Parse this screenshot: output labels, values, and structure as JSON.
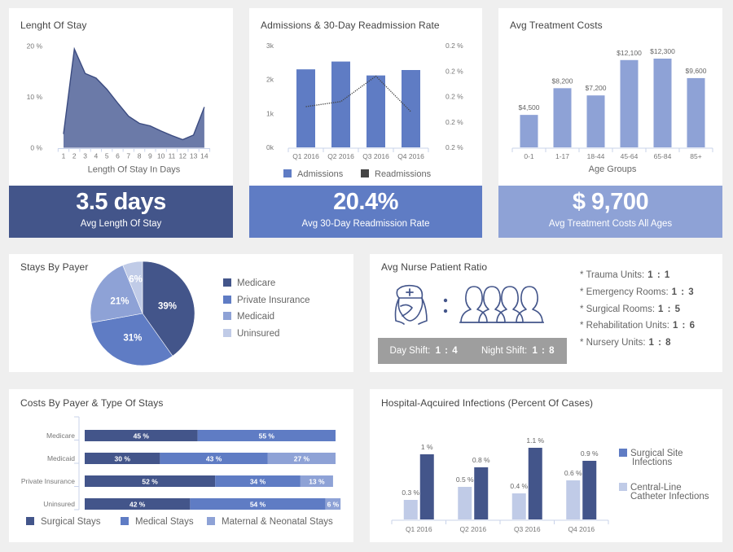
{
  "colors": {
    "navy": "#43558a",
    "blue": "#5f7cc4",
    "light_blue": "#8ea2d6",
    "pale_blue": "#c0cbe7",
    "gray": "#9e9e9e",
    "dark_gray": "#444444",
    "background": "#efefef"
  },
  "length_of_stay": {
    "title": "Lenght Of Stay",
    "kpi_value": "3.5 days",
    "kpi_label": "Avg Length Of Stay"
  },
  "admissions": {
    "title": "Admissions & 30-Day Readmission Rate",
    "kpi_value": "20.4%",
    "kpi_label": "Avg 30-Day Readmission Rate"
  },
  "treatment_costs": {
    "title": "Avg Treatment Costs",
    "kpi_value": "$ 9,700",
    "kpi_label": "Avg Treatment Costs All Ages"
  },
  "stays_by_payer": {
    "title": "Stays By Payer"
  },
  "nurse_ratio": {
    "title": "Avg Nurse Patient Ratio",
    "separator": ":",
    "day_shift_label": "Day Shift:",
    "day_shift_value": "1 : 4",
    "night_shift_label": "Night Shift:",
    "night_shift_value": "1 : 8",
    "units": [
      {
        "label": "* Trauma Units:",
        "value": "1 : 1"
      },
      {
        "label": "* Emergency Rooms:",
        "value": "1 : 3"
      },
      {
        "label": "* Surgical Rooms:",
        "value": "1 : 5"
      },
      {
        "label": "* Rehabilitation Units:",
        "value": "1 : 6"
      },
      {
        "label": "* Nursery Units:",
        "value": "1 : 8"
      }
    ]
  },
  "costs_by_payer": {
    "title": "Costs By Payer & Type Of Stays"
  },
  "infections": {
    "title": "Hospital-Aqcuired Infections (Percent Of Cases)"
  },
  "chart_data": [
    {
      "id": "length_of_stay",
      "type": "area",
      "title": "Lenght Of Stay",
      "xlabel": "Length Of Stay In Days",
      "ylabel": "",
      "x": [
        1,
        2,
        3,
        4,
        5,
        6,
        7,
        8,
        9,
        10,
        11,
        12,
        13,
        14
      ],
      "values": [
        2.7,
        19.4,
        14.6,
        13.7,
        11.5,
        8.8,
        6.2,
        4.8,
        4.3,
        3.3,
        2.4,
        1.6,
        2.5,
        8.0
      ],
      "ylim": [
        0,
        20
      ],
      "yticks": [
        0,
        10,
        20
      ],
      "ytick_labels": [
        "0 %",
        "10 %",
        "20 %"
      ],
      "grid": false,
      "color": "#6b7aa8"
    },
    {
      "id": "admissions",
      "type": "bar",
      "title": "Admissions & 30-Day Readmission Rate",
      "categories": [
        "Q1 2016",
        "Q2 2016",
        "Q3 2016",
        "Q4 2016"
      ],
      "series": [
        {
          "name": "Admissions",
          "type": "bar",
          "axis": "left",
          "values": [
            2300,
            2530,
            2120,
            2280
          ],
          "color": "#5f7cc4"
        },
        {
          "name": "Readmissions",
          "type": "line",
          "axis": "right",
          "style": "dotted",
          "values": [
            0.19,
            0.195,
            0.22,
            0.185
          ],
          "color": "#444444"
        }
      ],
      "ylim": [
        0,
        3000
      ],
      "yticks": [
        0,
        1000,
        2000,
        3000
      ],
      "ytick_labels": [
        "0k",
        "1k",
        "2k",
        "3k"
      ],
      "y2lim": [
        0.15,
        0.25
      ],
      "y2tick_labels": [
        "0.2 %",
        "0.2 %",
        "0.2 %",
        "0.2 %",
        "0.2 %"
      ],
      "legend": "bottom",
      "grid": false
    },
    {
      "id": "treatment_costs",
      "type": "bar",
      "title": "Avg Treatment Costs",
      "xlabel": "Age Groups",
      "categories": [
        "0-1",
        "1-17",
        "18-44",
        "45-64",
        "65-84",
        "85+"
      ],
      "values": [
        4500,
        8200,
        7200,
        12100,
        12300,
        9600
      ],
      "data_labels": [
        "$4,500",
        "$8,200",
        "$7,200",
        "$12,100",
        "$12,300",
        "$9,600"
      ],
      "ylim": [
        0,
        14000
      ],
      "color": "#8ea2d6",
      "grid": false
    },
    {
      "id": "stays_by_payer",
      "type": "pie",
      "title": "Stays By Payer",
      "labels": [
        "Medicare",
        "Private Insurance",
        "Medicaid",
        "Uninsured"
      ],
      "values": [
        39,
        31,
        21,
        6
      ],
      "data_labels": [
        "39%",
        "31%",
        "21%",
        "6%"
      ],
      "colors": [
        "#43558a",
        "#5f7cc4",
        "#8ea2d6",
        "#c0cbe7"
      ],
      "legend": "right"
    },
    {
      "id": "costs_by_payer",
      "type": "bar",
      "orientation": "horizontal",
      "stacked": true,
      "title": "Costs By Payer & Type Of Stays",
      "categories": [
        "Medicare",
        "Medicaid",
        "Private Insurance",
        "Uninsured"
      ],
      "series": [
        {
          "name": "Surgical Stays",
          "values": [
            45,
            30,
            52,
            42
          ],
          "color": "#43558a"
        },
        {
          "name": "Medical Stays",
          "values": [
            55,
            43,
            34,
            54
          ],
          "color": "#5f7cc4"
        },
        {
          "name": "Maternal & Neonatal Stays",
          "values": [
            0,
            27,
            13,
            6
          ],
          "color": "#8ea2d6"
        }
      ],
      "value_suffix": " %",
      "xlim": [
        0,
        100
      ],
      "legend": "bottom"
    },
    {
      "id": "infections",
      "type": "bar",
      "title": "Hospital-Aqcuired Infections (Percent Of Cases)",
      "categories": [
        "Q1 2016",
        "Q2 2016",
        "Q3 2016",
        "Q4 2016"
      ],
      "series": [
        {
          "name": "Central-Line Catheter Infections",
          "values": [
            0.3,
            0.5,
            0.4,
            0.6
          ],
          "data_labels": [
            "0.3 %",
            "0.5 %",
            "0.4 %",
            "0.6 %"
          ],
          "color": "#c0cbe7"
        },
        {
          "name": "Surgical Site Infections",
          "values": [
            1.0,
            0.8,
            1.1,
            0.9
          ],
          "data_labels": [
            "1 %",
            "0.8 %",
            "1.1 %",
            "0.9 %"
          ],
          "color": "#43558a"
        }
      ],
      "legend_order": [
        "Surgical Site Infections",
        "Central-Line Catheter Infections"
      ],
      "legend_colors": [
        "#5f7cc4",
        "#c0cbe7"
      ],
      "ylim": [
        0,
        1.2
      ],
      "legend": "right",
      "grid": false
    }
  ]
}
